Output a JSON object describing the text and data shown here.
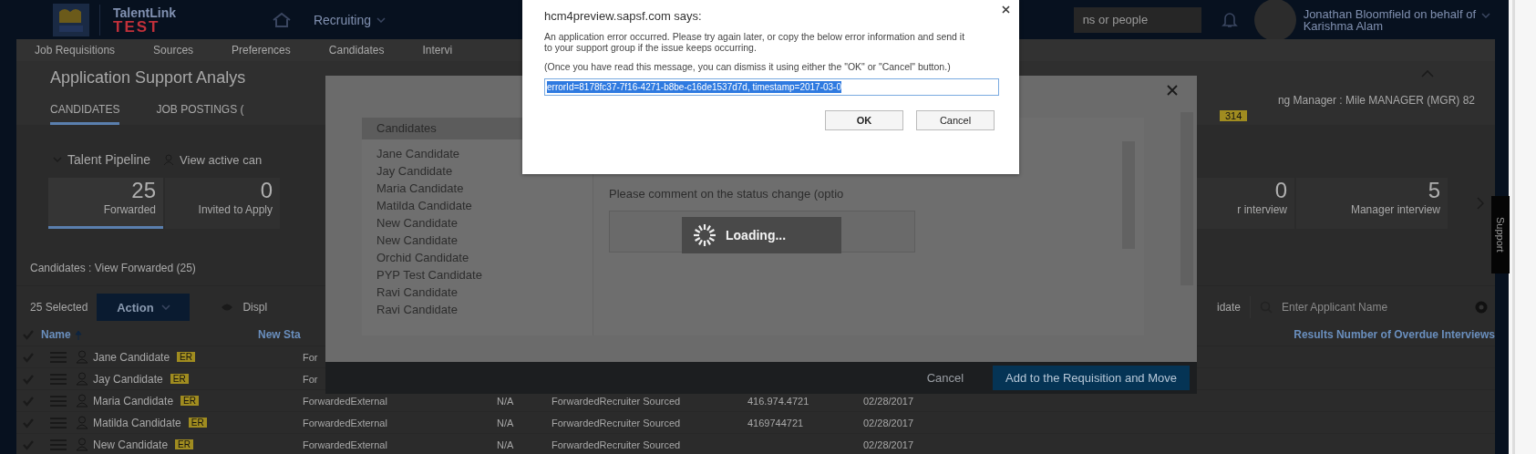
{
  "top_bar": {
    "brand": "TalentLink",
    "env": "TEST",
    "module": "Recruiting",
    "search_placeholder": "ns or people",
    "user_line1": "Jonathan Bloomfield on behalf of",
    "user_line2": "Karishma Alam"
  },
  "nav": [
    {
      "label": "Job Requisitions"
    },
    {
      "label": "Sources"
    },
    {
      "label": "Preferences"
    },
    {
      "label": "Candidates"
    },
    {
      "label": "Intervi"
    }
  ],
  "page": {
    "title": "Application Support Analys",
    "tabs": [
      {
        "label": "CANDIDATES",
        "selected": true
      },
      {
        "label": "JOB POSTINGS (",
        "selected": false
      }
    ],
    "info": "ng Manager : Mile MANAGER (MGR) 82",
    "info_badge": "314"
  },
  "pipeline": {
    "title": "Talent Pipeline",
    "link": "View active can",
    "stages_left": [
      {
        "count": "25",
        "label": "Forwarded",
        "selected": true
      },
      {
        "count": "0",
        "label": "Invited to Apply",
        "selected": false
      }
    ],
    "stages_right": [
      {
        "count": "0",
        "label": "r interview",
        "selected": false
      },
      {
        "count": "5",
        "label": "Manager interview",
        "selected": false
      }
    ]
  },
  "candidates": {
    "heading": "Candidates : View Forwarded (25)",
    "selected_count": "25 Selected",
    "action": "Action",
    "display": "Displ",
    "filter_label": "idate",
    "search_placeholder": "Enter Applicant Name",
    "header_checked": true,
    "name_column": "Name",
    "status_column": "New Sta",
    "right_column": "Results Number of Overdue Interviews",
    "rows": [
      {
        "checked": true,
        "name": "Jane Candidate",
        "badge": "ER",
        "cells": [
          "For"
        ]
      },
      {
        "checked": true,
        "name": "Jay Candidate",
        "badge": "ER",
        "cells": [
          "For"
        ]
      },
      {
        "checked": true,
        "name": "Maria Candidate",
        "badge": "ER",
        "cells": [
          "ForwardedExternal",
          "N/A",
          "ForwardedRecruiter Sourced",
          "416.974.4721",
          "02/28/2017"
        ]
      },
      {
        "checked": true,
        "name": "Matilda Candidate",
        "badge": "ER",
        "cells": [
          "ForwardedExternal",
          "N/A",
          "ForwardedRecruiter Sourced",
          "4169744721",
          "02/28/2017"
        ]
      },
      {
        "checked": true,
        "name": "New Candidate",
        "badge": "ER",
        "cells": [
          "ForwardedExternal",
          "N/A",
          "ForwardedRecruiter Sourced",
          "",
          "02/28/2017"
        ]
      }
    ]
  },
  "support_tab": "Support",
  "modal": {
    "list_header": "Candidates",
    "list": [
      "Jane Candidate",
      "Jay Candidate",
      "Maria Candidate",
      "Matilda Candidate",
      "New Candidate",
      "New Candidate",
      "Orchid Candidate",
      "PYP Test Candidate",
      "Ravi Candidate",
      "Ravi Candidate"
    ],
    "comment_label": "Please comment on the status change (optio",
    "cancel": "Cancel",
    "confirm": "Add to the Requisition and Move"
  },
  "loading": {
    "text": "Loading..."
  },
  "alert": {
    "title": "hcm4preview.sapsf.com says:",
    "message": "An application error occurred. Please try again later, or copy the below error information and send it to your support group if the issue keeps occurring.",
    "note": "(Once you have read this message, you can dismiss it using either the \"OK\" or \"Cancel\" button.)",
    "value": "errorId=8178fc37-7f16-4271-b8be-c16de1537d7d, timestamp=2017-03-0",
    "ok": "OK",
    "cancel": "Cancel"
  }
}
